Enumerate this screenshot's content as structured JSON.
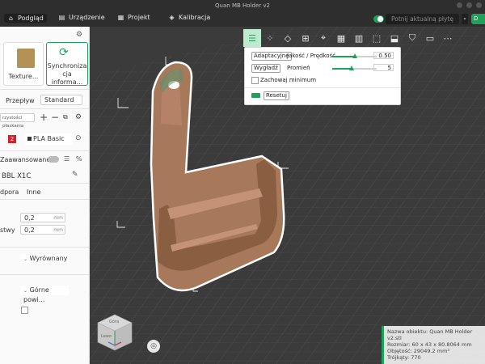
{
  "window": {
    "title": "Quan MB Holder v2"
  },
  "topbar": {
    "tabs": [
      {
        "label": "Podgląd",
        "icon": "home-icon"
      },
      {
        "label": "Urządzenie",
        "icon": "printer-icon"
      },
      {
        "label": "Projekt",
        "icon": "project-icon"
      },
      {
        "label": "Kalibracja",
        "icon": "calibration-icon"
      }
    ],
    "slice_label": "Potnij aktualną płytę",
    "export_label": "D"
  },
  "left": {
    "texture_label": "Texture...",
    "sync_label_line1": "Synchroniza",
    "sync_label_line2": "cja informa...",
    "flow_label": "Przepływ",
    "flow_value": "Standard",
    "plate_type_label": "rzystości płaskania",
    "filament_index": "2",
    "filament_name": "PLA Basic",
    "advanced_label": "Zaawansowane",
    "printer_name": "BBL X1C",
    "tab_support": "dpora",
    "tab_other": "Inne",
    "field1_value": "0,2",
    "field1_unit": "mm",
    "field2_label": "stwy",
    "field2_value": "0,2",
    "field2_unit": "mm",
    "align_value": "Wyrównany",
    "top_surface_value": "Górne powi..."
  },
  "adaptive_panel": {
    "adaptive_button": "Adaptacyjne",
    "quality_label": "Jakość / Prędkość",
    "quality_value": "0.50",
    "smooth_button": "Wygładź",
    "radius_label": "Promień",
    "radius_value": "5",
    "keep_min_label": "Zachowaj minimum",
    "reset_button": "Resetuj"
  },
  "viewcube": {
    "top_label": "Góra",
    "left_label": "Lewo"
  },
  "object_info": {
    "name_line": "Nazwa obiektu: Quan MB Holder v2.stl",
    "size_line": "Rozmiar: 60 x 43 x 80.8064 mm",
    "volume_line": "Objętość: 29049.2 mm³",
    "triangles_line": "Trójkąty: 770"
  },
  "colors": {
    "accent": "#1fa05b",
    "model": "#a7795a",
    "bed": "#3b3b3b"
  }
}
